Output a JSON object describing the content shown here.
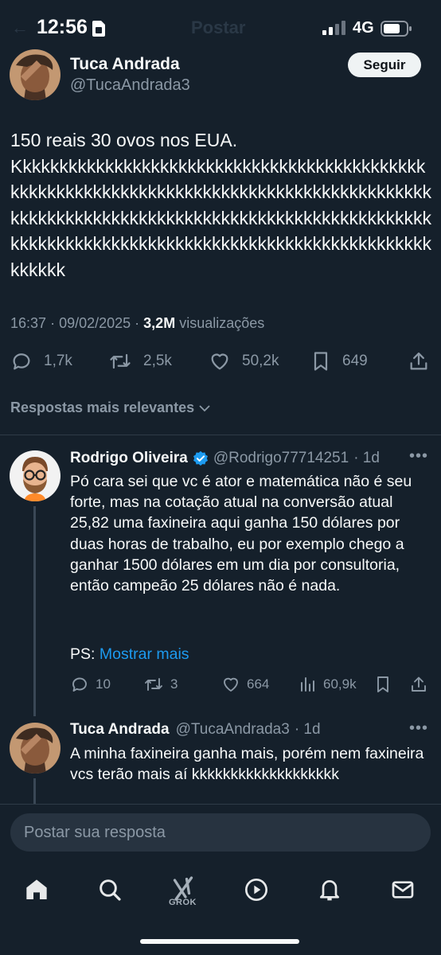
{
  "status_bar": {
    "time": "12:56",
    "network": "4G",
    "background_title": "Postar"
  },
  "main_post": {
    "author_name": "Tuca Andrada",
    "author_handle": "@TucaAndrada3",
    "follow_label": "Seguir",
    "text_line1": "150 reais 30 ovos nos EUA.",
    "text_line2": "Kkkkkkkkkkkkkkkkkkkkkkkkkkkkkkkkkkkkkkkkkkkkkkkkkkkkkkkkkkkkkkkkkkkkkkkkkkkkkkkkkkkkkkkkkkkkkkkkkkkkkkkkkkkkkkkkkkkkkkkkkkkkkkkkkkkkkkkkkkkkkkkkkkkkkkkkkkkkkkkkkkkkkkkkkkkkkkkkkkkkkkkkkkkkk",
    "time": "16:37",
    "date": "09/02/2025",
    "views_count": "3,2M",
    "views_label": "visualizações",
    "replies": "1,7k",
    "reposts": "2,5k",
    "likes": "50,2k",
    "bookmarks": "649"
  },
  "sort_label": "Respostas mais relevantes",
  "replies": [
    {
      "author_name": "Rodrigo Oliveira",
      "verified": true,
      "author_handle": "@Rodrigo77714251",
      "age": "· 1d",
      "text": "Pó cara sei que vc é ator e matemática não é seu forte, mas na cotação atual na conversão atual 25,82 uma faxineira aqui ganha 150 dólares por duas horas de trabalho, eu por exemplo chego a ganhar 1500 dólares em um dia por consultoria, então campeão 25 dólares não é nada.",
      "ps_prefix": "PS:",
      "show_more": "Mostrar mais",
      "replies": "10",
      "reposts": "3",
      "likes": "664",
      "views": "60,9k"
    },
    {
      "author_name": "Tuca Andrada",
      "author_handle": "@TucaAndrada3",
      "age": "· 1d",
      "text": "A minha faxineira ganha mais, porém nem faxineira vcs terão mais aí kkkkkkkkkkkkkkkkkkk"
    }
  ],
  "composer_placeholder": "Postar sua resposta",
  "nav": {
    "grok_label": "GROK"
  },
  "colors": {
    "background": "#15202b",
    "accent": "#1d9bf0",
    "muted_text": "#8b98a5"
  }
}
